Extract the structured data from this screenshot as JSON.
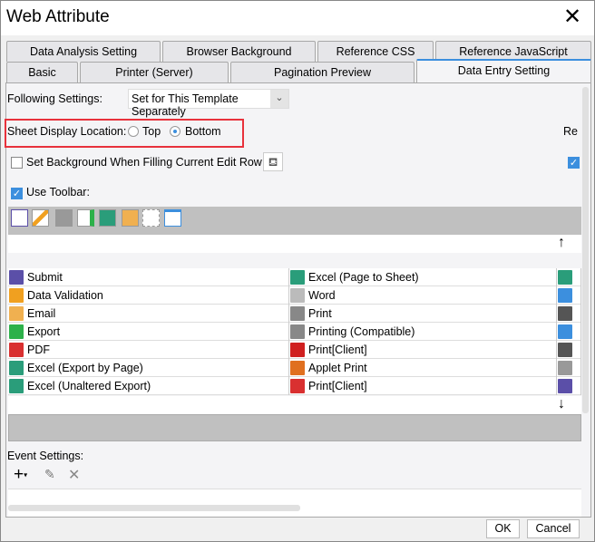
{
  "window": {
    "title": "Web Attribute"
  },
  "tabs_row1": [
    "Data Analysis Setting",
    "Browser Background",
    "Reference CSS",
    "Reference JavaScript"
  ],
  "tabs_row2": [
    "Basic",
    "Printer (Server)",
    "Pagination Preview",
    "Data Entry Setting"
  ],
  "active_tab": "Data Entry Setting",
  "following": {
    "label": "Following Settings:",
    "value": "Set for This Template Separately"
  },
  "sheet_location": {
    "label": "Sheet Display Location:",
    "options": [
      "Top",
      "Bottom"
    ],
    "selected": "Bottom"
  },
  "right_cut_label": "Re",
  "set_background": {
    "label": "Set Background When Filling Current Edit Row:",
    "checked": false
  },
  "use_toolbar": {
    "label": "Use Toolbar:",
    "checked": true
  },
  "toolbar_icons": [
    "submit-icon",
    "data-validation-icon",
    "print-icon",
    "export-icon",
    "excel-icon",
    "email-icon",
    "tree-icon",
    "window-icon"
  ],
  "buttons_table": [
    [
      {
        "label": "Submit",
        "icon": "submit-icon",
        "color": "#5b4fa8"
      },
      {
        "label": "Excel (Page to Sheet)",
        "icon": "excel-icon",
        "color": "#2a9d7a"
      },
      {
        "icon": "excel-icon",
        "color": "#2a9d7a"
      }
    ],
    [
      {
        "label": "Data Validation",
        "icon": "data-validation-icon",
        "color": "#f0a020"
      },
      {
        "label": "Word",
        "icon": "word-icon",
        "color": "#bbb"
      },
      {
        "icon": "window-icon",
        "color": "#3c8fde"
      }
    ],
    [
      {
        "label": "Email",
        "icon": "email-icon",
        "color": "#f0b050"
      },
      {
        "label": "Print",
        "icon": "print-icon",
        "color": "#888"
      },
      {
        "icon": "tree-icon",
        "color": "#555"
      }
    ],
    [
      {
        "label": "Export",
        "icon": "export-icon",
        "color": "#2db14a"
      },
      {
        "label": "Printing (Compatible)",
        "icon": "print-icon",
        "color": "#888"
      },
      {
        "icon": "arrow-right-icon",
        "color": "#3c8fde"
      }
    ],
    [
      {
        "label": "PDF",
        "icon": "pdf-icon",
        "color": "#d93030"
      },
      {
        "label": "Print[Client]",
        "icon": "flash-print-icon",
        "color": "#d02020"
      },
      {
        "icon": "move-icon",
        "color": "#555"
      }
    ],
    [
      {
        "label": "Excel (Export by Page)",
        "icon": "excel-icon",
        "color": "#2a9d7a"
      },
      {
        "label": "Applet Print",
        "icon": "java-icon",
        "color": "#e07020"
      },
      {
        "icon": "gear-icon",
        "color": "#999"
      }
    ],
    [
      {
        "label": "Excel (Unaltered Export)",
        "icon": "excel-icon",
        "color": "#2a9d7a"
      },
      {
        "label": "Print[Client]",
        "icon": "pdf-print-icon",
        "color": "#d93030"
      },
      {
        "icon": "scheduled-save-icon",
        "color": "#5b4fa8"
      }
    ]
  ],
  "event_settings": {
    "label": "Event Settings:"
  },
  "footer": {
    "ok": "OK",
    "cancel": "Cancel"
  },
  "colors": {
    "accent": "#3c8fde",
    "highlight": "#e8323c"
  }
}
